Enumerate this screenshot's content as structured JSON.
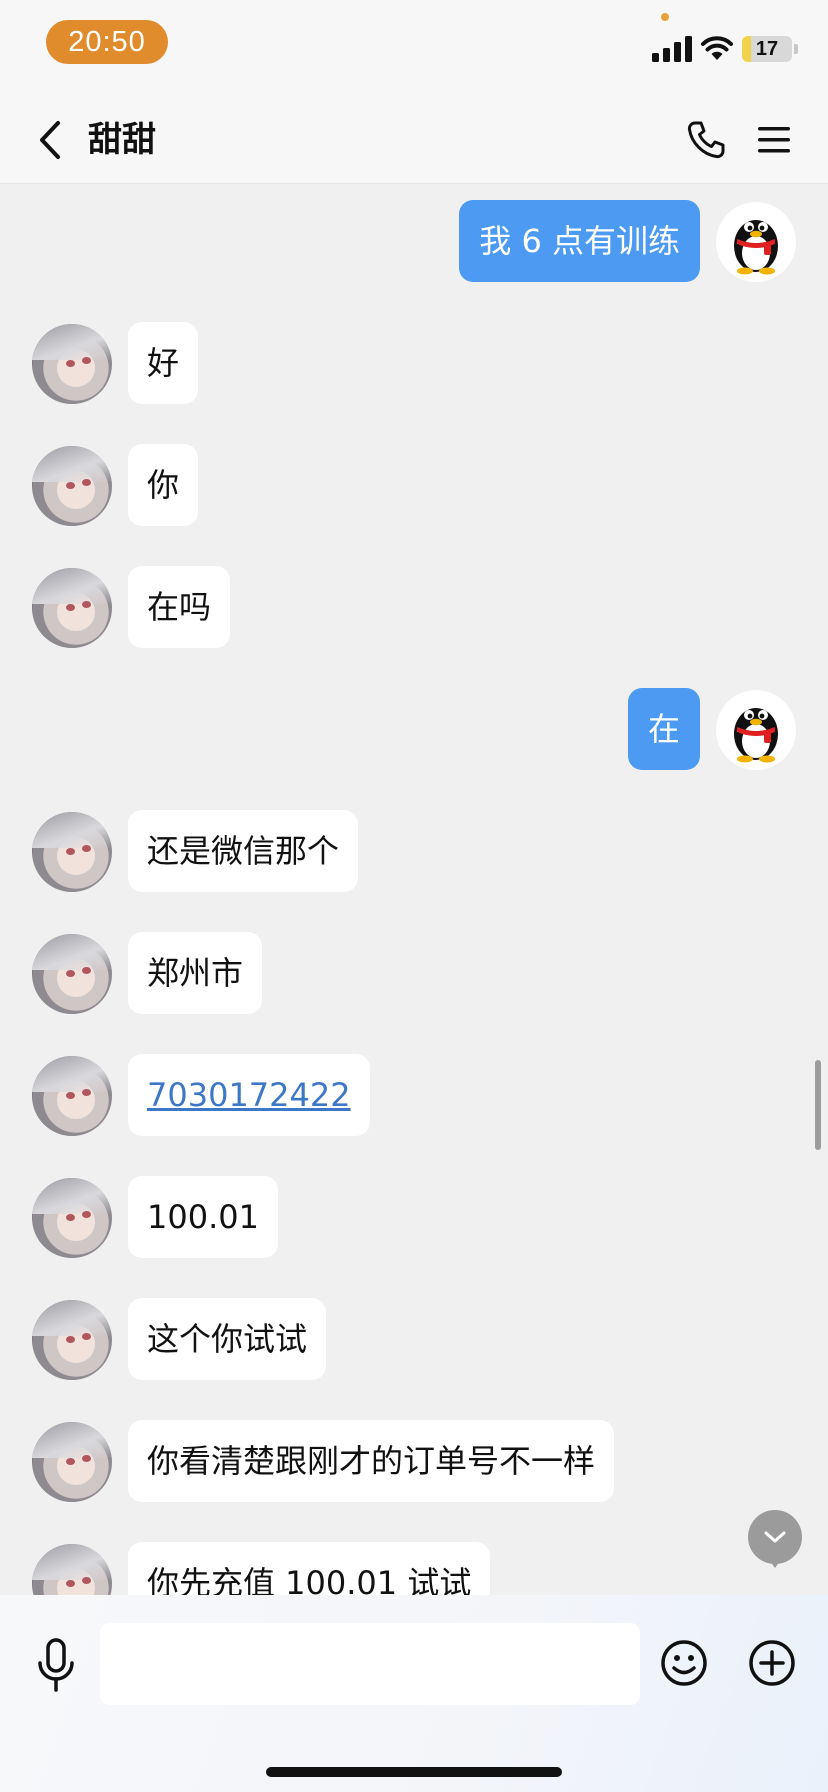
{
  "status_bar": {
    "time": "20:50",
    "battery_level": "17",
    "battery_fraction": 0.17
  },
  "nav": {
    "title": "甜甜",
    "back_icon": "chevron-left-icon",
    "call_icon": "phone-icon",
    "menu_icon": "menu-icon"
  },
  "colors": {
    "sent_bubble": "#4c9af2",
    "received_bubble": "#ffffff",
    "time_pill": "#e08b2c",
    "link": "#3d78c8"
  },
  "messages": [
    {
      "side": "right",
      "text": "我 6 点有训练"
    },
    {
      "side": "left",
      "text": "好"
    },
    {
      "side": "left",
      "text": "你"
    },
    {
      "side": "left",
      "text": "在吗"
    },
    {
      "side": "right",
      "text": "在"
    },
    {
      "side": "left",
      "text": "还是微信那个"
    },
    {
      "side": "left",
      "text": "郑州市"
    },
    {
      "side": "left",
      "text": "7030172422",
      "link": true
    },
    {
      "side": "left",
      "text": "100.01"
    },
    {
      "side": "left",
      "text": "这个你试试"
    },
    {
      "side": "left",
      "text": "你看清楚跟刚才的订单号不一样"
    },
    {
      "side": "left",
      "text": "你先充值 100.01 试试"
    }
  ],
  "input": {
    "value": "",
    "placeholder": "",
    "mic_icon": "microphone-icon",
    "emoji_icon": "smiley-icon",
    "plus_icon": "plus-icon"
  }
}
